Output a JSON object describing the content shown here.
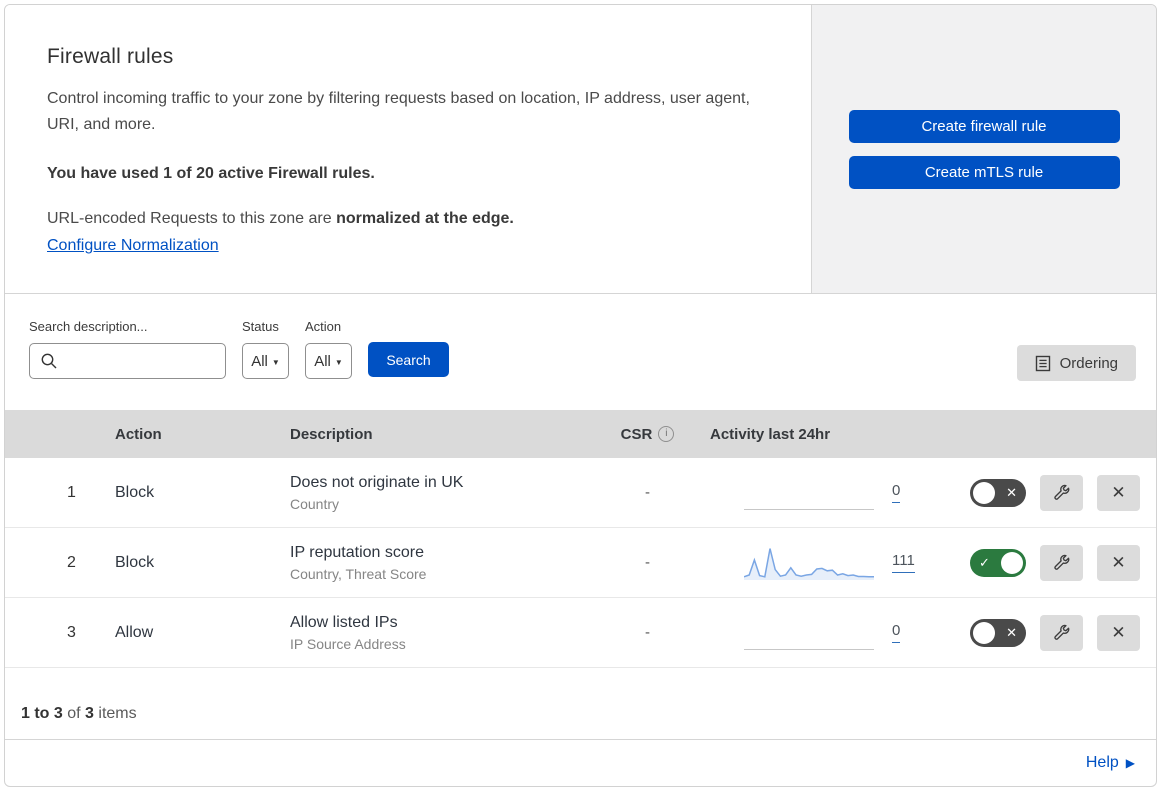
{
  "colors": {
    "accent_blue": "#0051c3",
    "toggle_on_green": "#2b7a3f",
    "toggle_off_gray": "#4a4a4a",
    "sparkline_blue": "#7aa6e4",
    "table_header_bg": "#dadada",
    "panel_gray": "#f1f1f2"
  },
  "header": {
    "title": "Firewall rules",
    "description": "Control incoming traffic to your zone by filtering requests based on location, IP address, user agent, URI, and more.",
    "usage": "You have used 1 of 20 active Firewall rules.",
    "normalization_prefix": "URL-encoded Requests to this zone are ",
    "normalization_bold": "normalized at the edge.",
    "normalization_link": "Configure Normalization",
    "create_firewall_button": "Create firewall rule",
    "create_mtls_button": "Create mTLS rule"
  },
  "filters": {
    "search_label": "Search description...",
    "search_value": "",
    "status_label": "Status",
    "status_value": "All",
    "action_label": "Action",
    "action_value": "All",
    "search_button": "Search",
    "ordering_button": "Ordering"
  },
  "table": {
    "columns": {
      "action": "Action",
      "description": "Description",
      "csr": "CSR",
      "csr_info": "i",
      "activity": "Activity last 24hr"
    },
    "rules": [
      {
        "priority": "1",
        "action": "Block",
        "description": "Does not originate in UK",
        "fields": "Country",
        "csr": "-",
        "activity_count": "0",
        "enabled": false,
        "sparkline": []
      },
      {
        "priority": "2",
        "action": "Block",
        "description": "IP reputation score",
        "fields": "Country, Threat Score",
        "csr": "-",
        "activity_count": "111",
        "enabled": true,
        "sparkline": [
          4,
          10,
          60,
          8,
          4,
          98,
          28,
          6,
          10,
          34,
          10,
          6,
          10,
          12,
          30,
          32,
          24,
          26,
          10,
          14,
          8,
          10,
          5,
          5,
          4,
          4
        ]
      },
      {
        "priority": "3",
        "action": "Allow",
        "description": "Allow listed IPs",
        "fields": "IP Source Address",
        "csr": "-",
        "activity_count": "0",
        "enabled": false,
        "sparkline": []
      }
    ]
  },
  "footer": {
    "range": "1 to 3",
    "of_word": "of",
    "total": "3",
    "items_word": "items",
    "help": "Help"
  }
}
